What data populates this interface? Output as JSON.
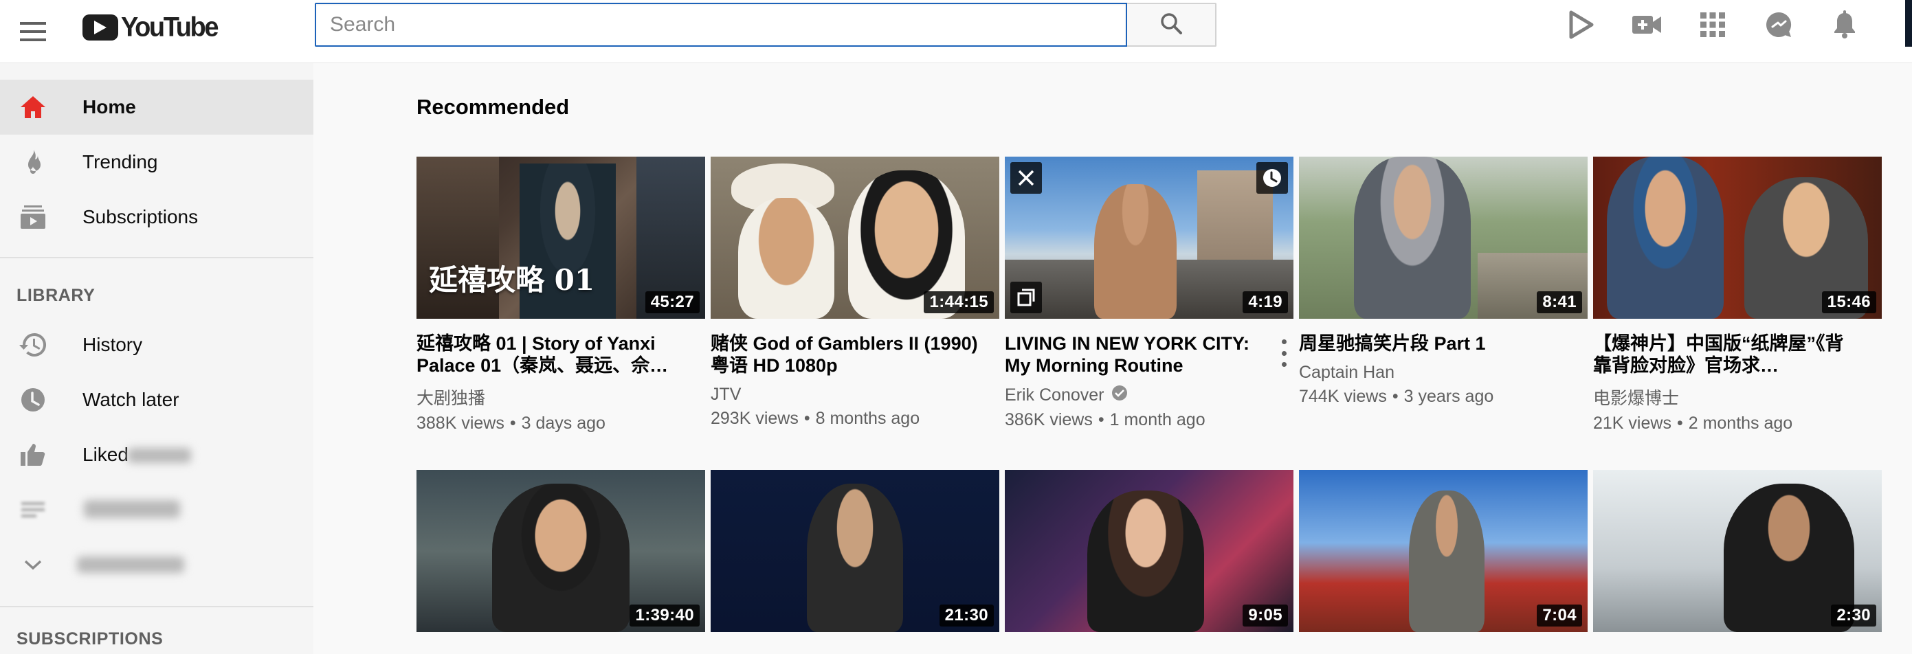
{
  "header": {
    "logo_text": "YouTube",
    "search_placeholder": "Search",
    "search_value": "",
    "icons": [
      "menu-icon",
      "youtube-logo",
      "search-icon",
      "youtube-play-icon",
      "create-video-icon",
      "apps-grid-icon",
      "messages-icon",
      "notifications-bell-icon"
    ]
  },
  "sidebar": {
    "main_items": [
      {
        "label": "Home",
        "icon": "home-icon"
      },
      {
        "label": "Trending",
        "icon": "trending-flame-icon"
      },
      {
        "label": "Subscriptions",
        "icon": "subscriptions-icon"
      }
    ],
    "library_heading": "LIBRARY",
    "library_items": [
      {
        "label": "History",
        "icon": "history-icon"
      },
      {
        "label": "Watch later",
        "icon": "watch-later-clock-icon"
      },
      {
        "label": "Liked",
        "icon": "thumbs-up-icon"
      }
    ],
    "subscriptions_heading": "SUBSCRIPTIONS"
  },
  "main": {
    "section_title": "Recommended",
    "videos_row1": [
      {
        "title": "延禧攻略 01 | Story of Yanxi Palace 01（秦岚、聂远、佘…",
        "channel": "大剧独播",
        "views": "388K views",
        "age": "3 days ago",
        "duration": "45:27",
        "thumb_caption": "延禧攻略  01"
      },
      {
        "title": "赌侠 God of Gamblers II (1990) 粤语 HD 1080p",
        "channel": "JTV",
        "views": "293K views",
        "age": "8 months ago",
        "duration": "1:44:15"
      },
      {
        "title": "LIVING IN NEW YORK CITY: My Morning Routine",
        "channel": "Erik Conover",
        "views": "386K views",
        "age": "1 month ago",
        "duration": "4:19",
        "verified": true
      },
      {
        "title": "周星驰搞笑片段 Part 1",
        "channel": "Captain Han",
        "views": "744K views",
        "age": "3 years ago",
        "duration": "8:41"
      },
      {
        "title": "【爆神片】中国版“纸牌屋”《背靠背脸对脸》官场求…",
        "channel": "电影爆博士",
        "views": "21K views",
        "age": "2 months ago",
        "duration": "15:46"
      }
    ],
    "videos_row2": [
      {
        "duration": "1:39:40"
      },
      {
        "duration": "21:30"
      },
      {
        "duration": "9:05"
      },
      {
        "duration": "7:04"
      },
      {
        "duration": "2:30"
      }
    ]
  },
  "colors": {
    "brand_red": "#ff0000",
    "home_icon_red": "#e52d27",
    "search_border": "#1c62b9",
    "meta_gray": "#606060"
  }
}
